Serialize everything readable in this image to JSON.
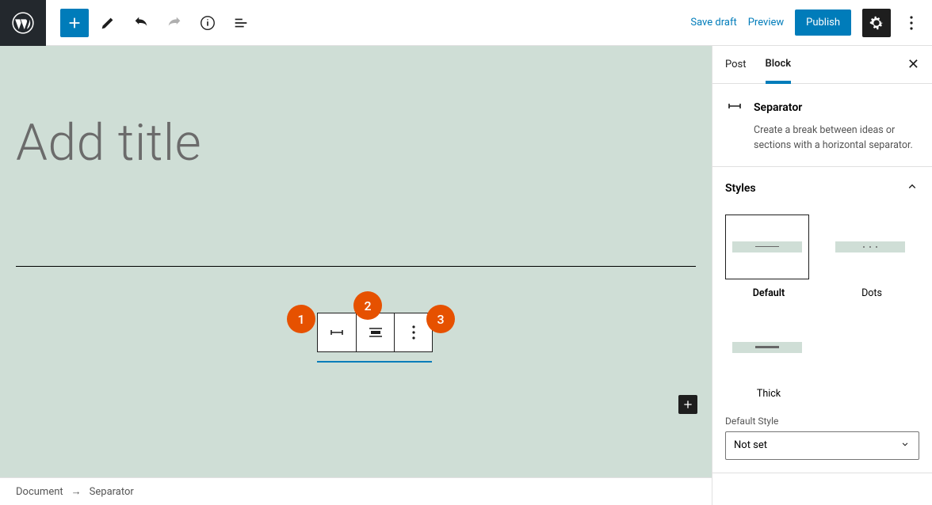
{
  "topbar": {
    "save_draft": "Save draft",
    "preview": "Preview",
    "publish": "Publish"
  },
  "editor": {
    "title_placeholder": "Add title"
  },
  "annotations": [
    "1",
    "2",
    "3"
  ],
  "sidebar": {
    "tabs": {
      "post": "Post",
      "block": "Block"
    },
    "block_name": "Separator",
    "block_desc": "Create a break between ideas or sections with a horizontal separator.",
    "styles_title": "Styles",
    "styles": [
      {
        "key": "default",
        "label": "Default"
      },
      {
        "key": "dots",
        "label": "Dots"
      },
      {
        "key": "thick",
        "label": "Thick"
      }
    ],
    "default_style_label": "Default Style",
    "default_style_value": "Not set"
  },
  "footer": {
    "crumb1": "Document",
    "arrow": "→",
    "crumb2": "Separator"
  }
}
